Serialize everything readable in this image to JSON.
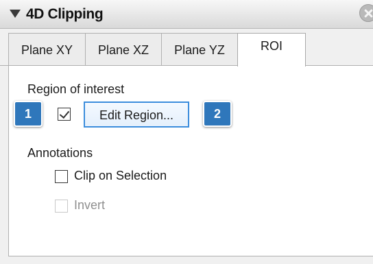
{
  "panel": {
    "title": "4D Clipping"
  },
  "tabs": [
    {
      "label": "Plane XY",
      "active": false
    },
    {
      "label": "Plane XZ",
      "active": false
    },
    {
      "label": "Plane YZ",
      "active": false
    },
    {
      "label": "ROI",
      "active": true
    }
  ],
  "roi": {
    "region_label": "Region of interest",
    "region_checked": true,
    "edit_region_label": "Edit Region...",
    "annotations_label": "Annotations",
    "clip_on_selection_label": "Clip on Selection",
    "clip_on_selection_checked": false,
    "invert_label": "Invert",
    "invert_checked": false,
    "invert_enabled": false
  },
  "callouts": {
    "one": "1",
    "two": "2"
  },
  "colors": {
    "accent": "#3c8ddc",
    "badge": "#2f77bb"
  }
}
